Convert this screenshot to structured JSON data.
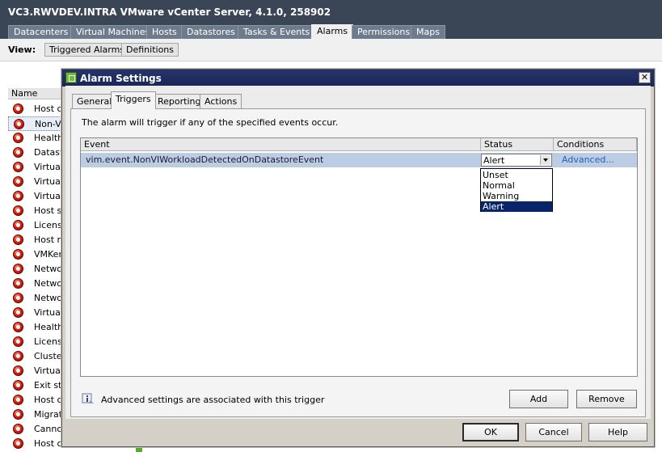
{
  "window": {
    "title": "VC3.RWVDEV.INTRA VMware vCenter Server, 4.1.0, 258902"
  },
  "main_tabs": [
    {
      "label": "Datacenters"
    },
    {
      "label": "Virtual Machines"
    },
    {
      "label": "Hosts"
    },
    {
      "label": "Datastores"
    },
    {
      "label": "Tasks & Events"
    },
    {
      "label": "Alarms",
      "active": true
    },
    {
      "label": "Permissions"
    },
    {
      "label": "Maps"
    }
  ],
  "view_bar": {
    "label": "View:",
    "buttons": [
      {
        "label": "Triggered Alarms"
      },
      {
        "label": "Definitions"
      }
    ]
  },
  "alarm_list": {
    "header": "Name",
    "items": [
      "Host co",
      "Non-VI",
      "Health",
      "Datast",
      "Virtual",
      "Virtual",
      "Virtual",
      "Host se",
      "License",
      "Host m",
      "VMKern",
      "Netwo",
      "Netwo",
      "Netwo",
      "Virtual",
      "Health",
      "License",
      "Cluster",
      "Virtual",
      "Exit sta",
      "Host cp",
      "Migrati",
      "Cannot",
      "Host co"
    ],
    "selected_index": 1
  },
  "dialog": {
    "title": "Alarm Settings",
    "close_glyph": "✕",
    "tabs": [
      {
        "label": "General"
      },
      {
        "label": "Triggers",
        "active": true
      },
      {
        "label": "Reporting"
      },
      {
        "label": "Actions"
      }
    ],
    "info_text": "The alarm will trigger if any of the specified events occur.",
    "grid": {
      "columns": [
        "Event",
        "Status",
        "Conditions"
      ],
      "rows": [
        {
          "event": "vim.event.NonVIWorkloadDetectedOnDatastoreEvent",
          "status": "Alert",
          "conditions": "Advanced..."
        }
      ]
    },
    "status_options": [
      "Unset",
      "Normal",
      "Warning",
      "Alert"
    ],
    "status_selected": "Alert",
    "advanced_note": "Advanced settings are associated with this trigger",
    "buttons": {
      "add": "Add",
      "remove": "Remove",
      "ok": "OK",
      "cancel": "Cancel",
      "help": "Help"
    }
  },
  "colors": {
    "title_bar": "#3a4656",
    "dialog_title": "#1a2656",
    "selected_row": "#bccce2",
    "dropdown_selected": "#0a246a",
    "link": "#1f5fbf",
    "alarm_icon": "#e02010"
  }
}
